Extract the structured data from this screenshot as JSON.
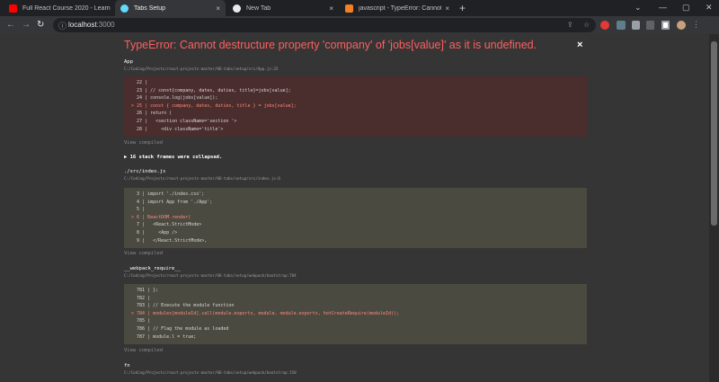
{
  "tabs": [
    {
      "title": "Full React Course 2020 - Learn Fu",
      "close": "×"
    },
    {
      "title": "Tabs Setup",
      "close": "×"
    },
    {
      "title": "New Tab",
      "close": "×"
    },
    {
      "title": "javascript - TypeError: Cannot de",
      "close": "×"
    }
  ],
  "new_tab": "+",
  "window_controls": {
    "menu": "⌄",
    "minimize": "—",
    "maximize": "▢",
    "close": "✕"
  },
  "toolbar": {
    "back": "←",
    "forward": "→",
    "reload": "↻",
    "url_host": "localhost",
    "url_port": ":3000",
    "share": "⇪",
    "star": "☆",
    "menu": "⋮"
  },
  "overlay": {
    "title": "TypeError: Cannot destructure property 'company' of 'jobs[value]' as it is undefined.",
    "close": "×"
  },
  "frames": [
    {
      "name": "App",
      "path": "C:/Coding/Projects/react-projects-master/06-tabs/setup/src/App.js:25",
      "lines": [
        "  22 |",
        "  23 | // const{company, dates, duties, title}=jobs[value];",
        "  24 | console.log(jobs[value]);",
        "> 25 | const { company, dates, duties, title } = jobs[value];",
        "  26 | return (",
        "  27 |   <section className='section '>",
        "  28 |     <div className='title'>"
      ],
      "view_compiled": "View compiled"
    },
    {
      "name": "./src/index.js",
      "path": "C:/Coding/Projects/react-projects-master/06-tabs/setup/src/index.js:6",
      "lines": [
        "  3 | import './index.css';",
        "  4 | import App from './App';",
        "  5 |",
        "> 6 | ReactDOM.render(",
        "  7 |   <React.StrictMode>",
        "  8 |     <App />",
        "  9 |   </React.StrictMode>,"
      ],
      "view_compiled": "View compiled"
    },
    {
      "name": "__webpack_require__",
      "path": "C:/Coding/Projects/react-projects-master/06-tabs/setup/webpack/bootstrap:784",
      "lines": [
        "  781 | };",
        "  782 |",
        "  783 | // Execute the module function",
        "> 784 | modules[moduleId].call(module.exports, module, module.exports, hotCreateRequire(moduleId));",
        "  785 |",
        "  786 | // Flag the module as loaded",
        "  787 | module.l = true;"
      ],
      "view_compiled": "View compiled"
    },
    {
      "name": "fn",
      "path": "C:/Coding/Projects/react-projects-master/06-tabs/setup/webpack/bootstrap:150"
    }
  ],
  "collapsed_note": "▶ 16 stack frames were collapsed.",
  "colors": {
    "error_title": "#ff5f5f",
    "error_box": "#4a2d2d",
    "neutral_box": "#4a4a40",
    "page_bg": "#353535"
  }
}
